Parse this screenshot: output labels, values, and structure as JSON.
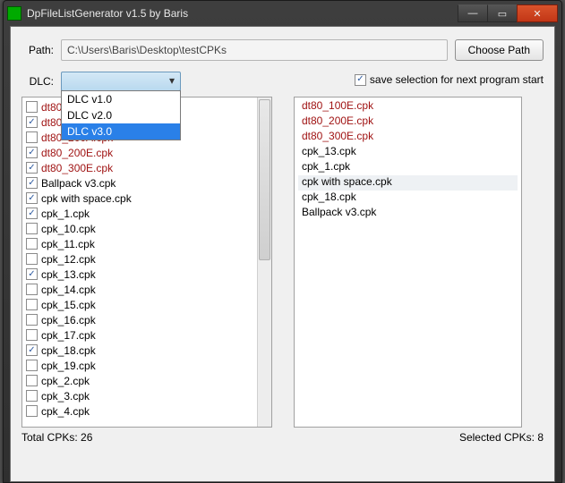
{
  "window": {
    "title": "DpFileListGenerator v1.5 by Baris"
  },
  "pathrow": {
    "label": "Path:",
    "value": "C:\\Users\\Baris\\Desktop\\testCPKs",
    "choose": "Choose Path"
  },
  "dlcrow": {
    "label": "DLC:",
    "options": [
      "DLC v1.0",
      "DLC v2.0",
      "DLC v3.0"
    ],
    "selected": "DLC v3.0"
  },
  "save_selection": {
    "checked": true,
    "label": "save selection for next program start"
  },
  "left": {
    "items": [
      {
        "label": "dt80 written over",
        "checked": false,
        "red": true
      },
      {
        "label": "dt80_ over",
        "checked": true,
        "red": true
      },
      {
        "label": "dt80_200A.cpk",
        "checked": false,
        "red": true
      },
      {
        "label": "dt80_200E.cpk",
        "checked": true,
        "red": true
      },
      {
        "label": "dt80_300E.cpk",
        "checked": true,
        "red": true
      },
      {
        "label": "Ballpack v3.cpk",
        "checked": true,
        "red": false
      },
      {
        "label": "cpk with space.cpk",
        "checked": true,
        "red": false
      },
      {
        "label": "cpk_1.cpk",
        "checked": true,
        "red": false
      },
      {
        "label": "cpk_10.cpk",
        "checked": false,
        "red": false
      },
      {
        "label": "cpk_11.cpk",
        "checked": false,
        "red": false
      },
      {
        "label": "cpk_12.cpk",
        "checked": false,
        "red": false
      },
      {
        "label": "cpk_13.cpk",
        "checked": true,
        "red": false
      },
      {
        "label": "cpk_14.cpk",
        "checked": false,
        "red": false
      },
      {
        "label": "cpk_15.cpk",
        "checked": false,
        "red": false
      },
      {
        "label": "cpk_16.cpk",
        "checked": false,
        "red": false
      },
      {
        "label": "cpk_17.cpk",
        "checked": false,
        "red": false
      },
      {
        "label": "cpk_18.cpk",
        "checked": true,
        "red": false
      },
      {
        "label": "cpk_19.cpk",
        "checked": false,
        "red": false
      },
      {
        "label": "cpk_2.cpk",
        "checked": false,
        "red": false
      },
      {
        "label": "cpk_3.cpk",
        "checked": false,
        "red": false
      },
      {
        "label": "cpk_4.cpk",
        "checked": false,
        "red": false
      }
    ]
  },
  "right": {
    "items": [
      {
        "label": "dt80_100E.cpk",
        "red": true,
        "hl": false
      },
      {
        "label": "dt80_200E.cpk",
        "red": true,
        "hl": false
      },
      {
        "label": "dt80_300E.cpk",
        "red": true,
        "hl": false
      },
      {
        "label": "cpk_13.cpk",
        "red": false,
        "hl": false
      },
      {
        "label": "cpk_1.cpk",
        "red": false,
        "hl": false
      },
      {
        "label": "cpk with space.cpk",
        "red": false,
        "hl": true
      },
      {
        "label": "cpk_18.cpk",
        "red": false,
        "hl": false
      },
      {
        "label": "Ballpack v3.cpk",
        "red": false,
        "hl": false
      }
    ]
  },
  "footer": {
    "total_label": "Total CPKs: 26",
    "selected_label": "Selected CPKs: 8"
  }
}
